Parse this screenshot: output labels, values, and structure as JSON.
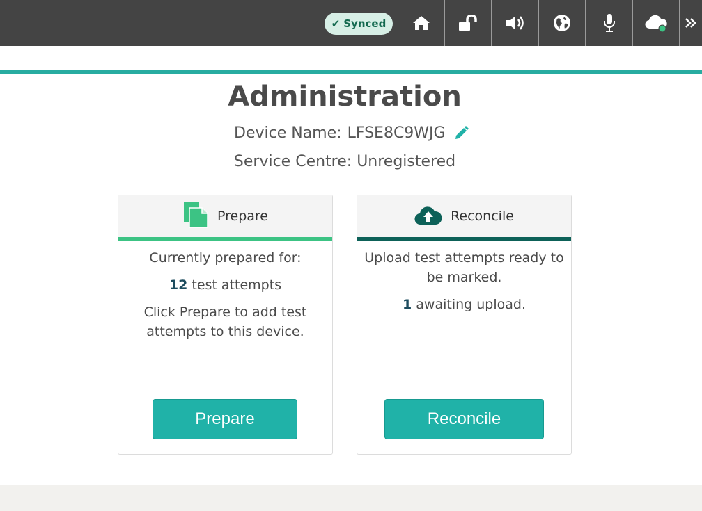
{
  "topbar": {
    "sync_status": "Synced",
    "icons": [
      "home-icon",
      "unlock-icon",
      "speaker-icon",
      "globe-icon",
      "microphone-icon",
      "cloud-online-icon",
      "more-chevrons-icon"
    ]
  },
  "page": {
    "title": "Administration",
    "device_label": "Device Name:",
    "device_name": "LFSE8C9WJG",
    "service_label": "Service Centre:",
    "service_value": "Unregistered"
  },
  "prepare_card": {
    "title": "Prepare",
    "line1": "Currently prepared for:",
    "count": "12",
    "count_suffix": "test attempts",
    "line3": "Click Prepare to add test attempts to this device.",
    "button": "Prepare",
    "accent": "#3cc384"
  },
  "reconcile_card": {
    "title": "Reconcile",
    "line1": "Upload test attempts ready to be marked.",
    "count": "1",
    "count_suffix": "awaiting upload.",
    "button": "Reconcile",
    "accent": "#0d6158"
  },
  "colors": {
    "topbar": "#444444",
    "teal": "#20b2a8",
    "synced_bg": "#d7efe6"
  }
}
